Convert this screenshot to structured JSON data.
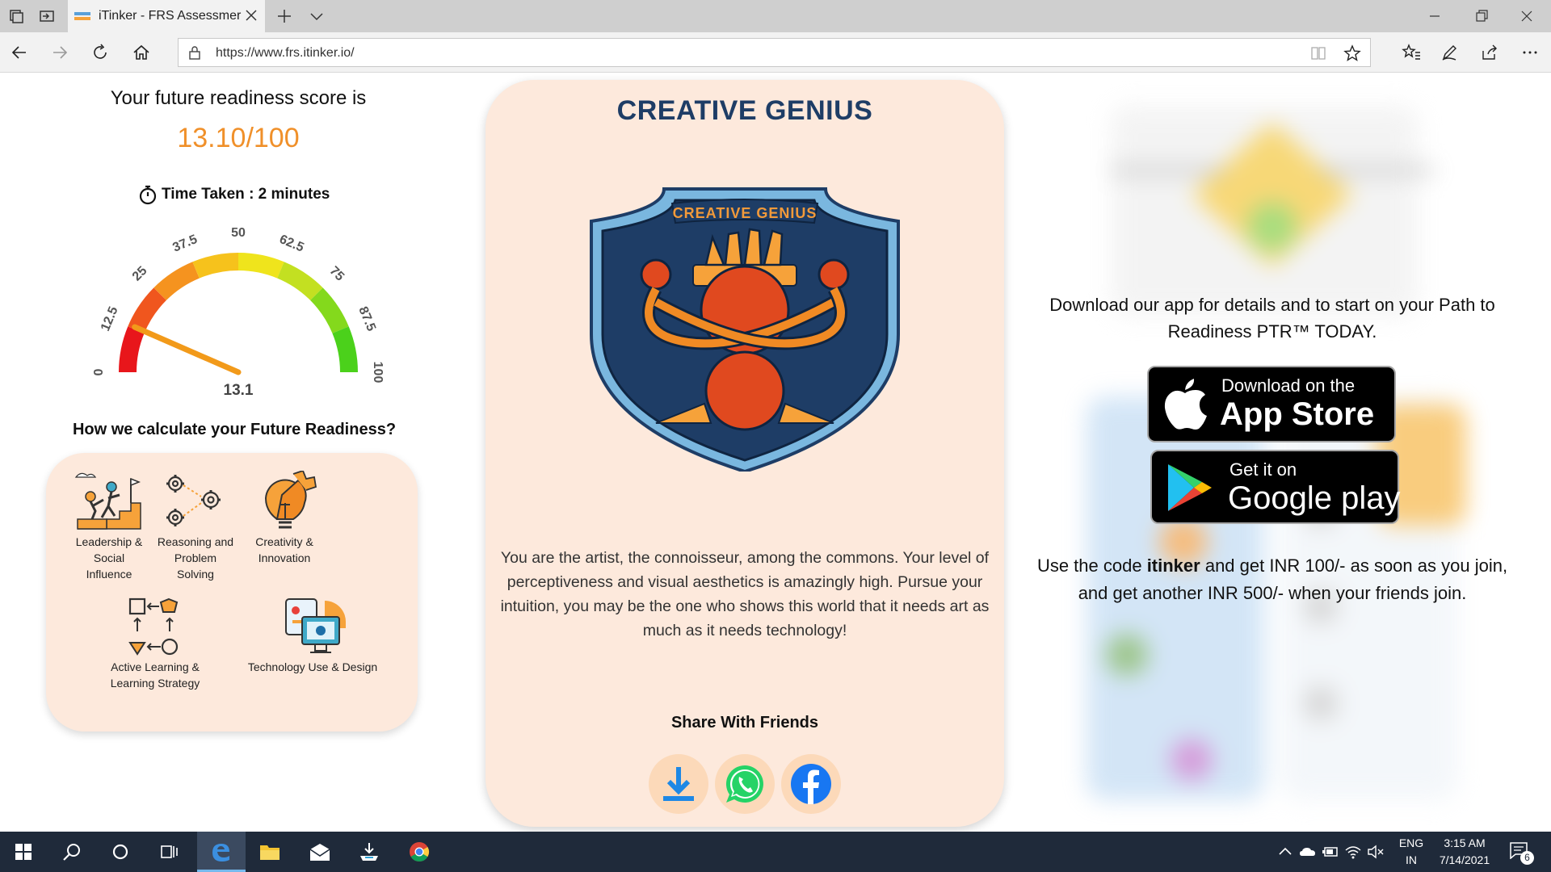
{
  "browser": {
    "tab_title": "iTinker - FRS Assessmer",
    "url": "https://www.frs.itinker.io/"
  },
  "score": {
    "title": "Your future readiness score is",
    "value": "13.10/100",
    "time_taken": "Time Taken : 2 minutes",
    "gauge": {
      "value": 13.1,
      "value_label": "13.1",
      "min": 0,
      "max": 100,
      "tick_labels": [
        "0",
        "12.5",
        "25",
        "37.5",
        "50",
        "62.5",
        "75",
        "87.5",
        "100"
      ],
      "zone_colors": [
        "#e8161b",
        "#f0561e",
        "#f5931f",
        "#f6c21c",
        "#efe41c",
        "#c3e021",
        "#84d91c",
        "#4bd11b"
      ],
      "needle_color": "#f29a1a"
    }
  },
  "calculation": {
    "title": "How we calculate your Future Readiness?",
    "items": [
      {
        "label_lines": [
          "Leadership &",
          "Social",
          "Influence"
        ],
        "icon": "leadership-icon"
      },
      {
        "label_lines": [
          "Reasoning and",
          "Problem",
          "Solving"
        ],
        "icon": "gears-icon"
      },
      {
        "label_lines": [
          "Creativity &",
          "Innovation"
        ],
        "icon": "lightbulb-puzzle-icon"
      },
      {
        "label_lines": [
          "Active Learning &",
          "Learning Strategy"
        ],
        "icon": "flow-shapes-icon"
      },
      {
        "label_lines": [
          "Technology Use & Design"
        ],
        "icon": "devices-icon"
      }
    ]
  },
  "persona": {
    "title": "CREATIVE GENIUS",
    "badge_text": "CREATIVE GENIUS",
    "description": "You are the artist, the connoisseur, among the commons. Your level of perceptiveness and visual aesthetics is amazingly high. Pursue your intuition, you may be the one who shows this world that it needs art as much as it needs technology!",
    "share_title": "Share With Friends"
  },
  "app_promo": {
    "download_text": "Download our app for details and to start on your Path to Readiness PTR™ TODAY.",
    "app_store_small": "Download on the",
    "app_store_big": "App Store",
    "google_small": "Get it on",
    "google_big": "Google play",
    "code_prefix": "Use the code ",
    "code": "itinker",
    "code_suffix": " and get INR 100/- as soon as you join, and get another INR 500/- when your friends join."
  },
  "taskbar": {
    "lang_top": "ENG",
    "lang_bottom": "IN",
    "time": "3:15 AM",
    "date": "7/14/2021",
    "notifications": "6"
  },
  "colors": {
    "accent_orange": "#f0902a",
    "persona_blue": "#1e3d66",
    "card_peach": "#fde9dc"
  }
}
